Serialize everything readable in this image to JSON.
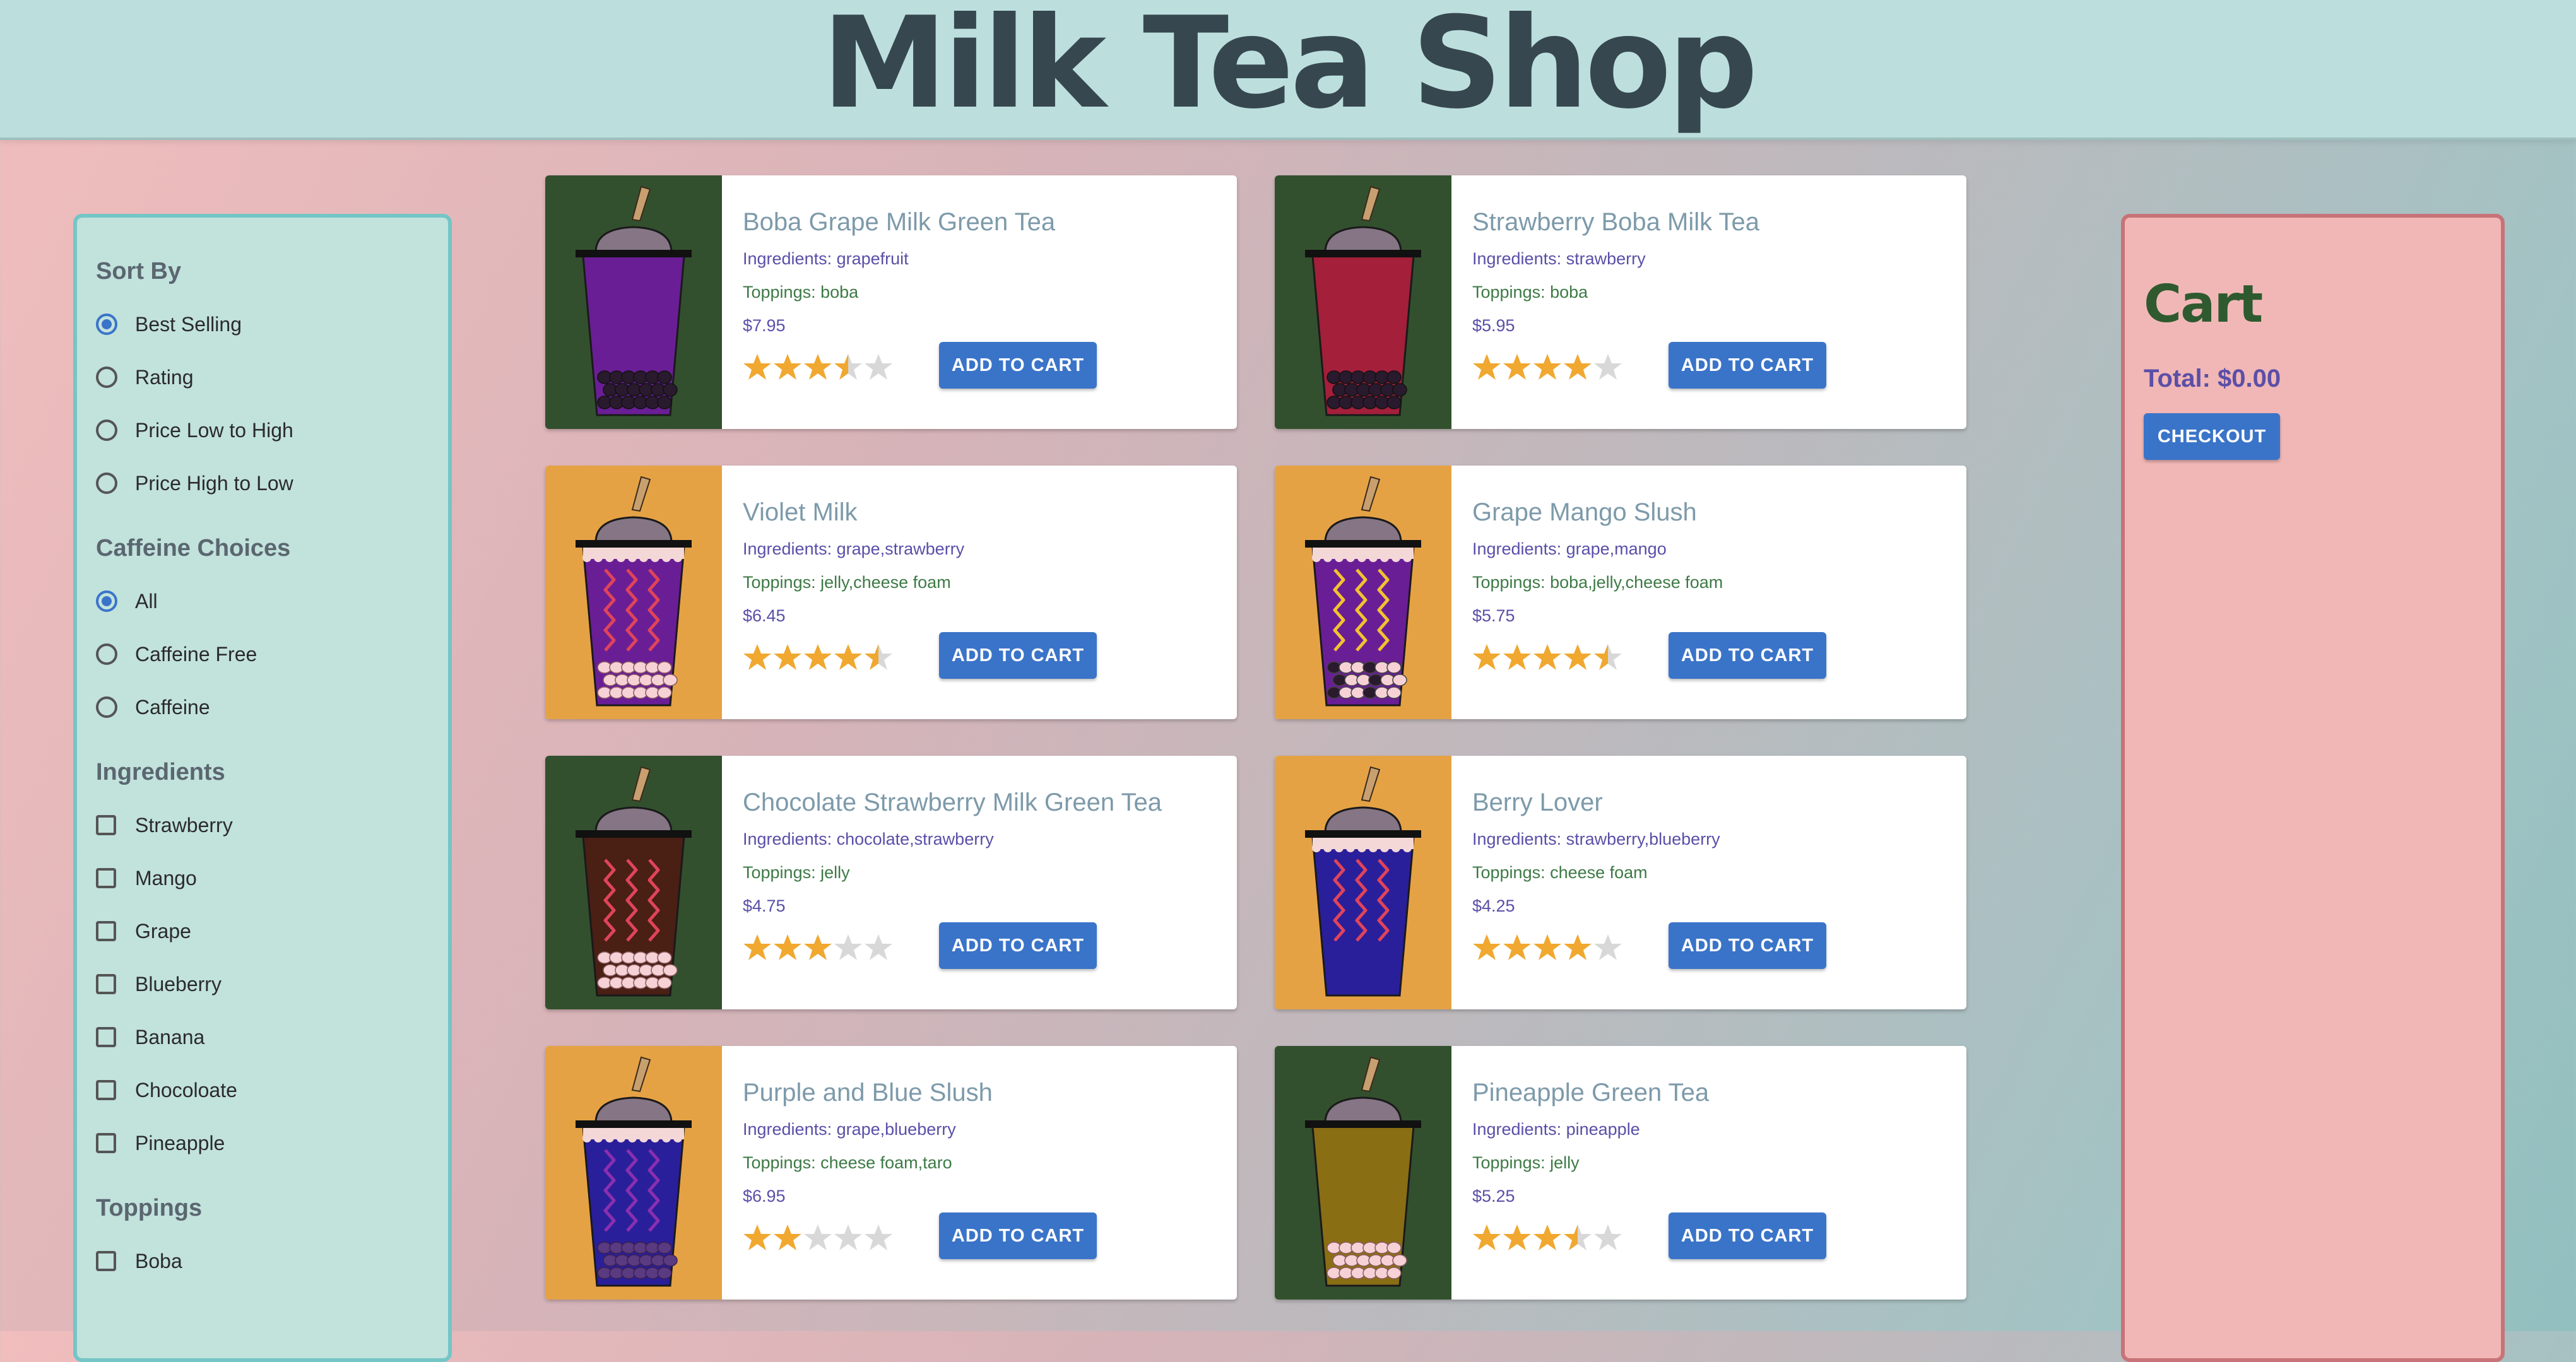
{
  "header": {
    "title": "Milk Tea Shop"
  },
  "sidebar": {
    "sort_heading": "Sort By",
    "sort_options": [
      "Best Selling",
      "Rating",
      "Price Low to High",
      "Price High to Low"
    ],
    "sort_selected": "Best Selling",
    "caffeine_heading": "Caffeine Choices",
    "caffeine_options": [
      "All",
      "Caffeine Free",
      "Caffeine"
    ],
    "caffeine_selected": "All",
    "ingredients_heading": "Ingredients",
    "ingredients": [
      "Strawberry",
      "Mango",
      "Grape",
      "Blueberry",
      "Banana",
      "Chocoloate",
      "Pineapple"
    ],
    "toppings_heading": "Toppings",
    "toppings": [
      "Boba"
    ]
  },
  "products": [
    {
      "name": "Boba Grape Milk Green Tea",
      "ingredients": "Ingredients: grapefruit",
      "toppings": "Toppings: boba",
      "price": "$7.95",
      "rating": 3.5,
      "button": "ADD TO CART",
      "bg": "#33502e",
      "tea": "#6a1e96",
      "foam": false,
      "swirl": false,
      "pearl": "boba"
    },
    {
      "name": "Strawberry Boba Milk Tea",
      "ingredients": "Ingredients: strawberry",
      "toppings": "Toppings: boba",
      "price": "$5.95",
      "rating": 4,
      "button": "ADD TO CART",
      "bg": "#33502e",
      "tea": "#a31f3a",
      "foam": false,
      "swirl": false,
      "pearl": "boba"
    },
    {
      "name": "Violet Milk",
      "ingredients": "Ingredients: grape,strawberry",
      "toppings": "Toppings: jelly,cheese foam",
      "price": "$6.45",
      "rating": 4.5,
      "button": "ADD TO CART",
      "bg": "#e5a245",
      "tea": "#6a1e96",
      "foam": true,
      "swirl": true,
      "swirlColor": "#e0445a",
      "pearl": "jelly"
    },
    {
      "name": "Grape Mango Slush",
      "ingredients": "Ingredients: grape,mango",
      "toppings": "Toppings: boba,jelly,cheese foam",
      "price": "$5.75",
      "rating": 4.5,
      "button": "ADD TO CART",
      "bg": "#e5a245",
      "tea": "#6a1e96",
      "foam": true,
      "swirl": true,
      "swirlColor": "#f2c230",
      "pearl": "mixed"
    },
    {
      "name": "Chocolate Strawberry Milk Green Tea",
      "ingredients": "Ingredients: chocolate,strawberry",
      "toppings": "Toppings: jelly",
      "price": "$4.75",
      "rating": 3,
      "button": "ADD TO CART",
      "bg": "#33502e",
      "tea": "#4a1f14",
      "foam": false,
      "swirl": true,
      "swirlColor": "#e0445a",
      "pearl": "jelly"
    },
    {
      "name": "Berry Lover",
      "ingredients": "Ingredients: strawberry,blueberry",
      "toppings": "Toppings: cheese foam",
      "price": "$4.25",
      "rating": 4,
      "button": "ADD TO CART",
      "bg": "#e5a245",
      "tea": "#2a1f9a",
      "foam": true,
      "swirl": true,
      "swirlColor": "#e0445a",
      "pearl": "none"
    },
    {
      "name": "Purple and Blue Slush",
      "ingredients": "Ingredients: grape,blueberry",
      "toppings": "Toppings: cheese foam,taro",
      "price": "$6.95",
      "rating": 2,
      "button": "ADD TO CART",
      "bg": "#e5a245",
      "tea": "#2a1f9a",
      "foam": true,
      "swirl": true,
      "swirlColor": "#8a2fb0",
      "pearl": "taro"
    },
    {
      "name": "Pineapple Green Tea",
      "ingredients": "Ingredients: pineapple",
      "toppings": "Toppings: jelly",
      "price": "$5.25",
      "rating": 3.5,
      "button": "ADD TO CART",
      "bg": "#33502e",
      "tea": "#8a6e14",
      "foam": false,
      "swirl": false,
      "pearl": "jelly"
    }
  ],
  "cart": {
    "title": "Cart",
    "total": "Total: $0.00",
    "checkout": "CHECKOUT"
  },
  "colors": {
    "accent": "#3a74c9",
    "star_on": "#f0a830",
    "star_off": "#d8d8d8"
  }
}
